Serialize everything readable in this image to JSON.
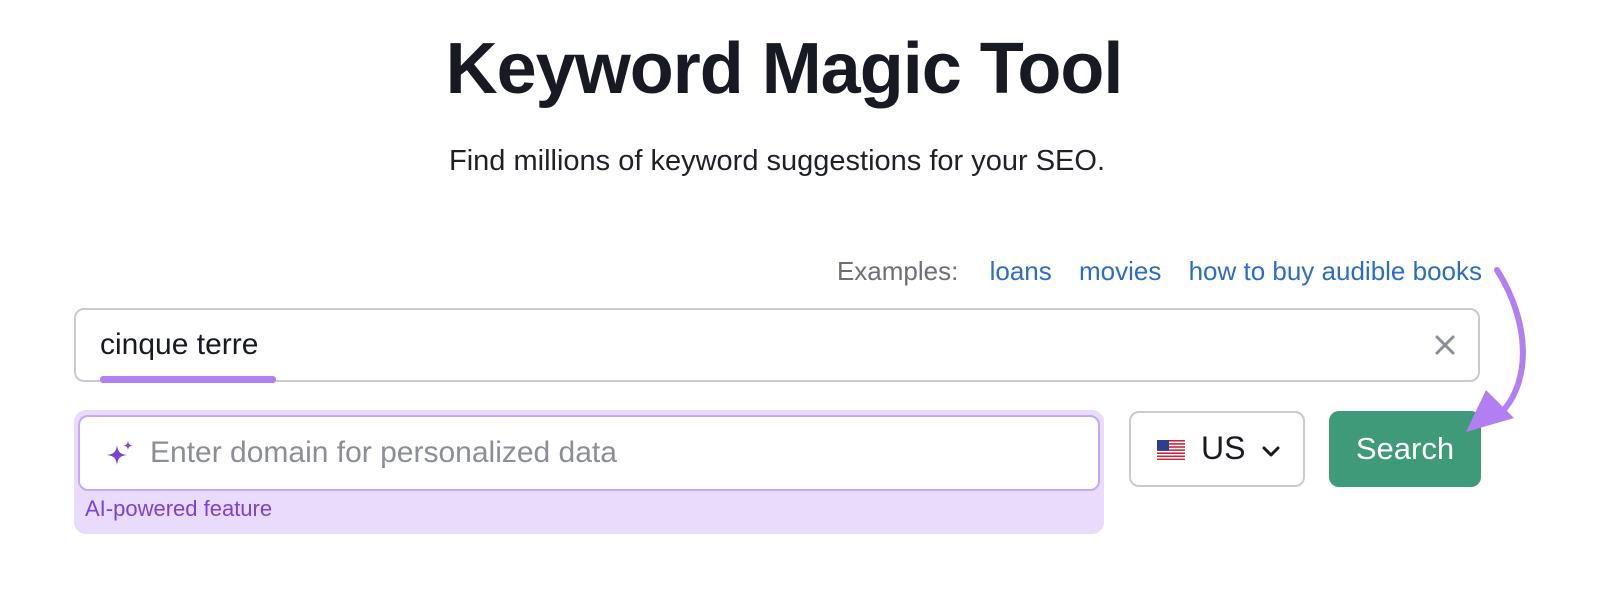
{
  "header": {
    "title": "Keyword Magic Tool",
    "subtitle": "Find millions of keyword suggestions for your SEO."
  },
  "examples": {
    "label": "Examples:",
    "links": [
      "loans",
      "movies",
      "how to buy audible books"
    ]
  },
  "keyword_input": {
    "value": "cinque terre",
    "clear_icon": "close-icon"
  },
  "domain_input": {
    "placeholder": "Enter domain for personalized data",
    "icon": "sparkle-icon",
    "ai_label": "AI-powered feature"
  },
  "country_select": {
    "selected": "US",
    "flag_icon": "us-flag-icon",
    "chevron_icon": "chevron-down-icon"
  },
  "search_button": {
    "label": "Search"
  },
  "colors": {
    "link": "#2b6cc4",
    "search_button": "#3e9a78",
    "ai_accent": "#7a43d6",
    "ai_background": "#e8dbfb",
    "annotation": "#b27ff3"
  }
}
